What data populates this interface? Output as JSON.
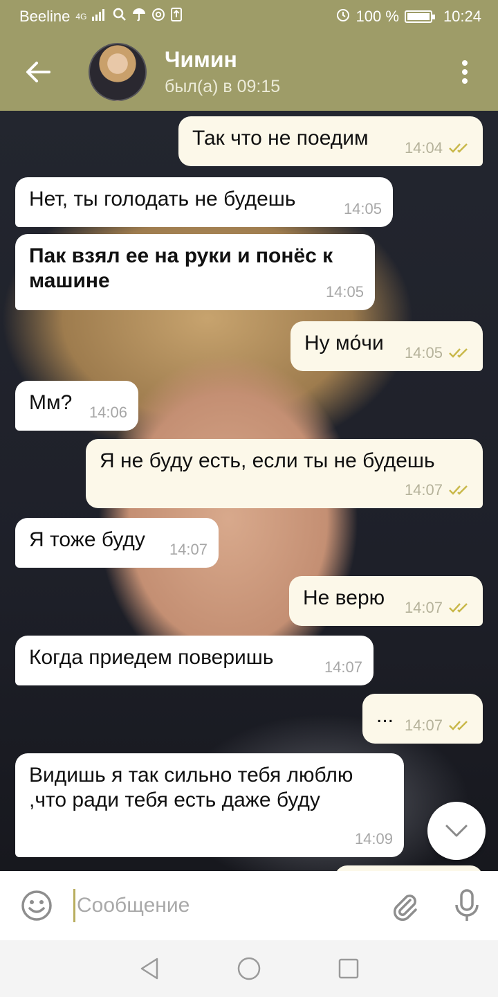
{
  "status_bar": {
    "carrier": "Beeline",
    "network": "4G",
    "battery": "100 %",
    "time": "10:24"
  },
  "header": {
    "contact_name": "Чимин",
    "contact_status": "был(а) в 09:15"
  },
  "messages": [
    {
      "dir": "out",
      "text": "Так что не поедим",
      "time": "14:04"
    },
    {
      "dir": "in",
      "text": "Нет, ты голодать не будешь",
      "time": "14:05"
    },
    {
      "dir": "in",
      "text": "Пак взял ее на руки и понёс к машине",
      "time": "14:05"
    },
    {
      "dir": "out",
      "text": "Ну мо́чи",
      "time": "14:05"
    },
    {
      "dir": "in",
      "text": "Мм?",
      "time": "14:06"
    },
    {
      "dir": "out",
      "text": "Я не буду есть, если ты не будешь",
      "time": "14:07"
    },
    {
      "dir": "in",
      "text": "Я тоже буду",
      "time": "14:07"
    },
    {
      "dir": "out",
      "text": "Не верю",
      "time": "14:07"
    },
    {
      "dir": "in",
      "text": "Когда приедем поверишь",
      "time": "14:07"
    },
    {
      "dir": "out",
      "text": "...",
      "time": "14:07"
    },
    {
      "dir": "in",
      "text": "Видишь я так сильно тебя люблю ,что ради тебя есть даже буду",
      "time": "14:09"
    }
  ],
  "input": {
    "placeholder": "Сообщение"
  },
  "icons": {
    "back": "back-arrow-icon",
    "menu": "more-vert-icon",
    "emoji": "emoji-icon",
    "attach": "paperclip-icon",
    "mic": "microphone-icon",
    "scroll": "chevron-down-icon"
  },
  "colors": {
    "header": "#9e9c68",
    "incoming_bubble": "#ffffff",
    "outgoing_bubble": "#fcf8e9",
    "read_checks": "#c9b84a"
  }
}
